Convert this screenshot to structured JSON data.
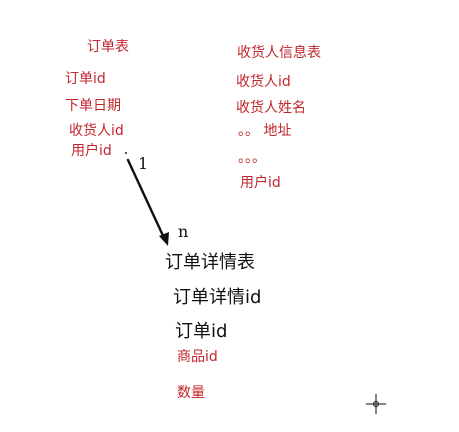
{
  "order_table": {
    "title": "订单表",
    "fields": [
      "订单id",
      "下单日期",
      "收货人id",
      "用户id"
    ]
  },
  "consignee_table": {
    "title": "收货人信息表",
    "fields": [
      "收货人id",
      "收货人姓名",
      "。。 地址",
      "。。。",
      "用户id"
    ]
  },
  "relation": {
    "one_label": "1",
    "many_label": "n"
  },
  "detail_table": {
    "title": "订单详情表",
    "fields": [
      "订单详情id",
      "订单id"
    ],
    "extra_fields": [
      "商品id",
      "数量"
    ]
  },
  "icons": {
    "arrow": "arrow-down-left",
    "cursor": "crosshair-cursor-icon"
  },
  "colors": {
    "red_text": "#c0272d",
    "black_text": "#111111"
  }
}
